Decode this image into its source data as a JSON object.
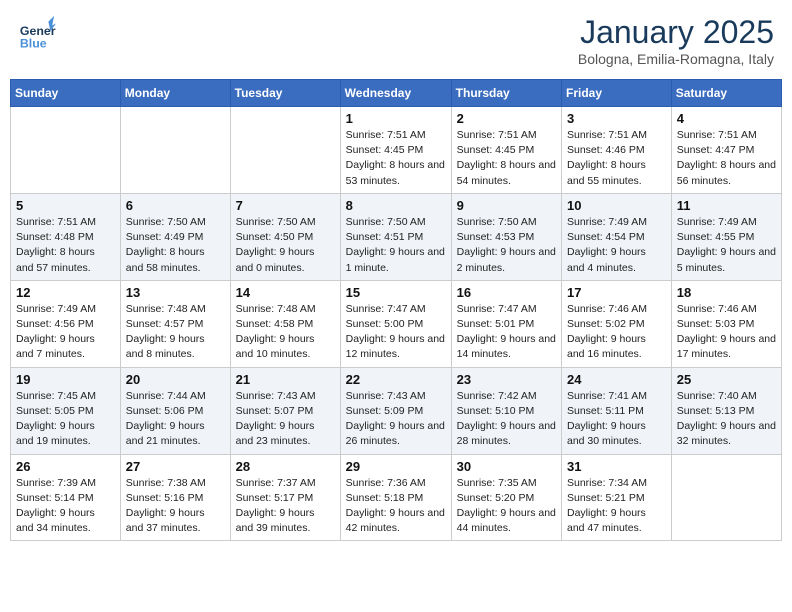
{
  "header": {
    "logo_general": "General",
    "logo_blue": "Blue",
    "title": "January 2025",
    "subtitle": "Bologna, Emilia-Romagna, Italy"
  },
  "weekdays": [
    "Sunday",
    "Monday",
    "Tuesday",
    "Wednesday",
    "Thursday",
    "Friday",
    "Saturday"
  ],
  "weeks": [
    [
      {
        "day": "",
        "sunrise": "",
        "sunset": "",
        "daylight": ""
      },
      {
        "day": "",
        "sunrise": "",
        "sunset": "",
        "daylight": ""
      },
      {
        "day": "",
        "sunrise": "",
        "sunset": "",
        "daylight": ""
      },
      {
        "day": "1",
        "sunrise": "Sunrise: 7:51 AM",
        "sunset": "Sunset: 4:45 PM",
        "daylight": "Daylight: 8 hours and 53 minutes."
      },
      {
        "day": "2",
        "sunrise": "Sunrise: 7:51 AM",
        "sunset": "Sunset: 4:45 PM",
        "daylight": "Daylight: 8 hours and 54 minutes."
      },
      {
        "day": "3",
        "sunrise": "Sunrise: 7:51 AM",
        "sunset": "Sunset: 4:46 PM",
        "daylight": "Daylight: 8 hours and 55 minutes."
      },
      {
        "day": "4",
        "sunrise": "Sunrise: 7:51 AM",
        "sunset": "Sunset: 4:47 PM",
        "daylight": "Daylight: 8 hours and 56 minutes."
      }
    ],
    [
      {
        "day": "5",
        "sunrise": "Sunrise: 7:51 AM",
        "sunset": "Sunset: 4:48 PM",
        "daylight": "Daylight: 8 hours and 57 minutes."
      },
      {
        "day": "6",
        "sunrise": "Sunrise: 7:50 AM",
        "sunset": "Sunset: 4:49 PM",
        "daylight": "Daylight: 8 hours and 58 minutes."
      },
      {
        "day": "7",
        "sunrise": "Sunrise: 7:50 AM",
        "sunset": "Sunset: 4:50 PM",
        "daylight": "Daylight: 9 hours and 0 minutes."
      },
      {
        "day": "8",
        "sunrise": "Sunrise: 7:50 AM",
        "sunset": "Sunset: 4:51 PM",
        "daylight": "Daylight: 9 hours and 1 minute."
      },
      {
        "day": "9",
        "sunrise": "Sunrise: 7:50 AM",
        "sunset": "Sunset: 4:53 PM",
        "daylight": "Daylight: 9 hours and 2 minutes."
      },
      {
        "day": "10",
        "sunrise": "Sunrise: 7:49 AM",
        "sunset": "Sunset: 4:54 PM",
        "daylight": "Daylight: 9 hours and 4 minutes."
      },
      {
        "day": "11",
        "sunrise": "Sunrise: 7:49 AM",
        "sunset": "Sunset: 4:55 PM",
        "daylight": "Daylight: 9 hours and 5 minutes."
      }
    ],
    [
      {
        "day": "12",
        "sunrise": "Sunrise: 7:49 AM",
        "sunset": "Sunset: 4:56 PM",
        "daylight": "Daylight: 9 hours and 7 minutes."
      },
      {
        "day": "13",
        "sunrise": "Sunrise: 7:48 AM",
        "sunset": "Sunset: 4:57 PM",
        "daylight": "Daylight: 9 hours and 8 minutes."
      },
      {
        "day": "14",
        "sunrise": "Sunrise: 7:48 AM",
        "sunset": "Sunset: 4:58 PM",
        "daylight": "Daylight: 9 hours and 10 minutes."
      },
      {
        "day": "15",
        "sunrise": "Sunrise: 7:47 AM",
        "sunset": "Sunset: 5:00 PM",
        "daylight": "Daylight: 9 hours and 12 minutes."
      },
      {
        "day": "16",
        "sunrise": "Sunrise: 7:47 AM",
        "sunset": "Sunset: 5:01 PM",
        "daylight": "Daylight: 9 hours and 14 minutes."
      },
      {
        "day": "17",
        "sunrise": "Sunrise: 7:46 AM",
        "sunset": "Sunset: 5:02 PM",
        "daylight": "Daylight: 9 hours and 16 minutes."
      },
      {
        "day": "18",
        "sunrise": "Sunrise: 7:46 AM",
        "sunset": "Sunset: 5:03 PM",
        "daylight": "Daylight: 9 hours and 17 minutes."
      }
    ],
    [
      {
        "day": "19",
        "sunrise": "Sunrise: 7:45 AM",
        "sunset": "Sunset: 5:05 PM",
        "daylight": "Daylight: 9 hours and 19 minutes."
      },
      {
        "day": "20",
        "sunrise": "Sunrise: 7:44 AM",
        "sunset": "Sunset: 5:06 PM",
        "daylight": "Daylight: 9 hours and 21 minutes."
      },
      {
        "day": "21",
        "sunrise": "Sunrise: 7:43 AM",
        "sunset": "Sunset: 5:07 PM",
        "daylight": "Daylight: 9 hours and 23 minutes."
      },
      {
        "day": "22",
        "sunrise": "Sunrise: 7:43 AM",
        "sunset": "Sunset: 5:09 PM",
        "daylight": "Daylight: 9 hours and 26 minutes."
      },
      {
        "day": "23",
        "sunrise": "Sunrise: 7:42 AM",
        "sunset": "Sunset: 5:10 PM",
        "daylight": "Daylight: 9 hours and 28 minutes."
      },
      {
        "day": "24",
        "sunrise": "Sunrise: 7:41 AM",
        "sunset": "Sunset: 5:11 PM",
        "daylight": "Daylight: 9 hours and 30 minutes."
      },
      {
        "day": "25",
        "sunrise": "Sunrise: 7:40 AM",
        "sunset": "Sunset: 5:13 PM",
        "daylight": "Daylight: 9 hours and 32 minutes."
      }
    ],
    [
      {
        "day": "26",
        "sunrise": "Sunrise: 7:39 AM",
        "sunset": "Sunset: 5:14 PM",
        "daylight": "Daylight: 9 hours and 34 minutes."
      },
      {
        "day": "27",
        "sunrise": "Sunrise: 7:38 AM",
        "sunset": "Sunset: 5:16 PM",
        "daylight": "Daylight: 9 hours and 37 minutes."
      },
      {
        "day": "28",
        "sunrise": "Sunrise: 7:37 AM",
        "sunset": "Sunset: 5:17 PM",
        "daylight": "Daylight: 9 hours and 39 minutes."
      },
      {
        "day": "29",
        "sunrise": "Sunrise: 7:36 AM",
        "sunset": "Sunset: 5:18 PM",
        "daylight": "Daylight: 9 hours and 42 minutes."
      },
      {
        "day": "30",
        "sunrise": "Sunrise: 7:35 AM",
        "sunset": "Sunset: 5:20 PM",
        "daylight": "Daylight: 9 hours and 44 minutes."
      },
      {
        "day": "31",
        "sunrise": "Sunrise: 7:34 AM",
        "sunset": "Sunset: 5:21 PM",
        "daylight": "Daylight: 9 hours and 47 minutes."
      },
      {
        "day": "",
        "sunrise": "",
        "sunset": "",
        "daylight": ""
      }
    ]
  ]
}
